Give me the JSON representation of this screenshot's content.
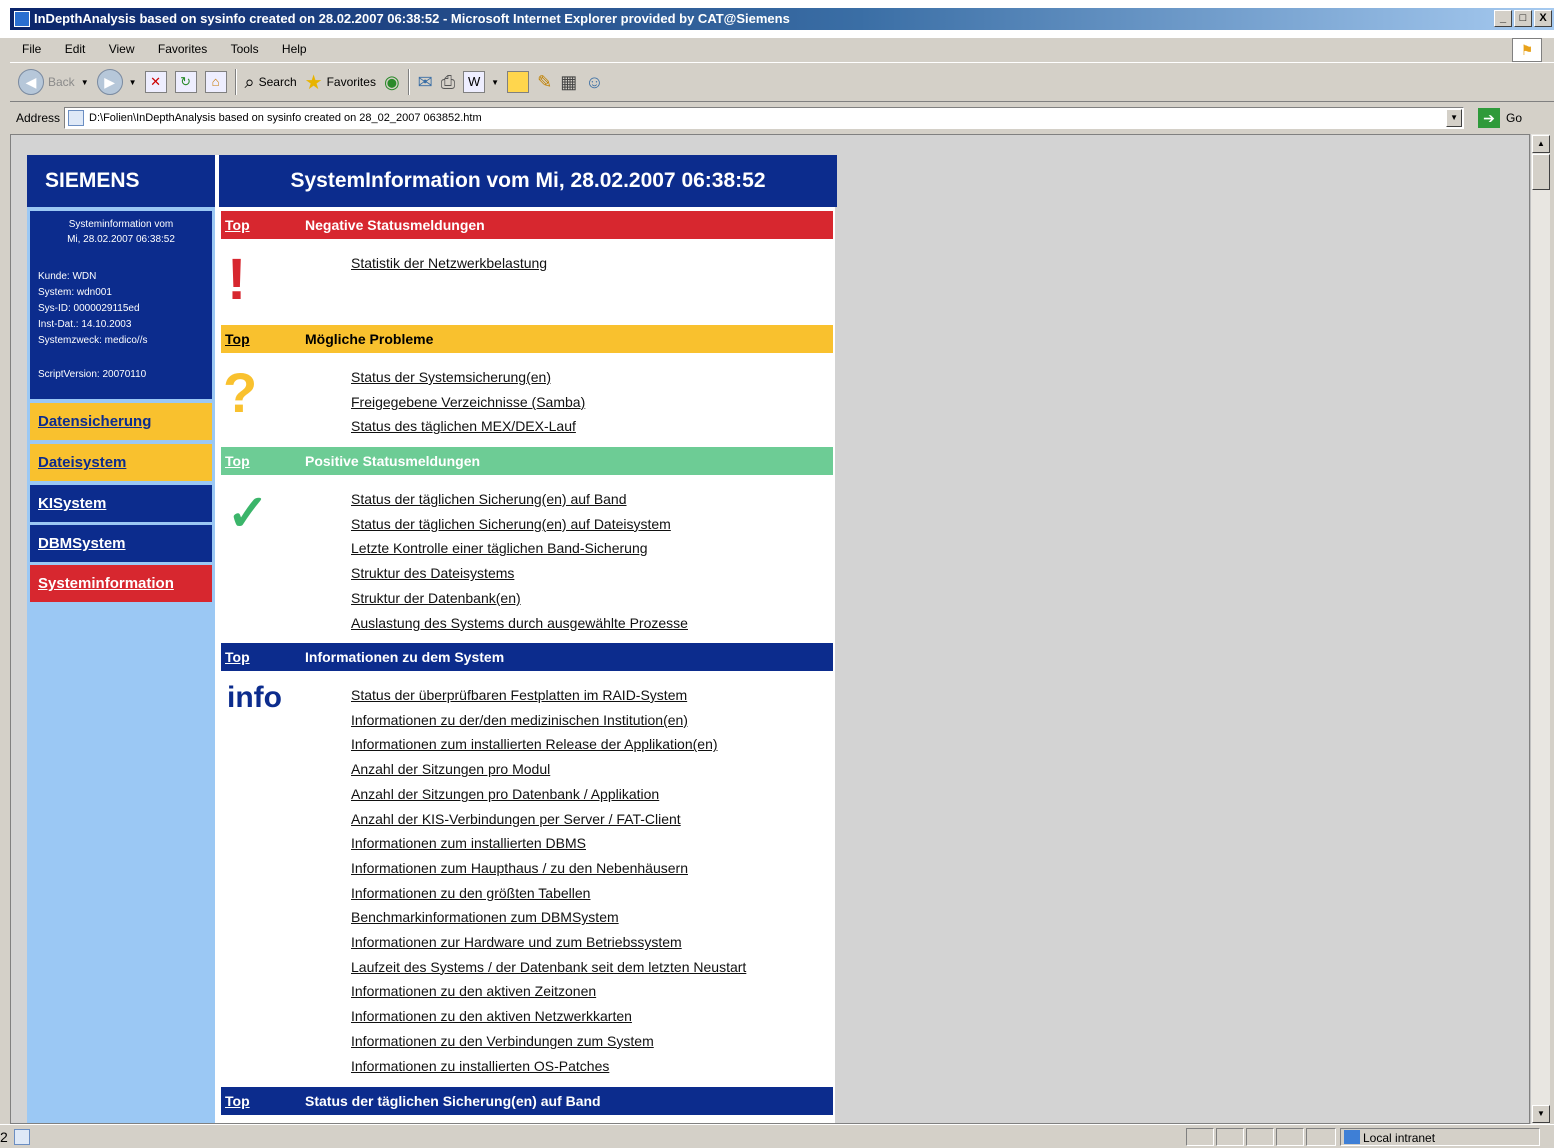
{
  "window": {
    "title": "InDepthAnalysis based on sysinfo created on 28.02.2007 06:38:52 - Microsoft Internet Explorer provided by CAT@Siemens",
    "buttons": [
      "_",
      "□",
      "X"
    ]
  },
  "menu": [
    "File",
    "Edit",
    "View",
    "Favorites",
    "Tools",
    "Help"
  ],
  "toolbar": {
    "back": "Back",
    "search": "Search",
    "favorites": "Favorites"
  },
  "address": {
    "label": "Address",
    "value": "D:\\Folien\\InDepthAnalysis based on sysinfo created on 28_02_2007 063852.htm",
    "go": "Go"
  },
  "sidebar": {
    "brand": "SIEMENS",
    "info_title_1": "Systeminformation vom",
    "info_title_2": "Mi, 28.02.2007 06:38:52",
    "kunde": "Kunde: WDN",
    "system": "System: wdn001",
    "sysid": "Sys-ID: 0000029115ed",
    "instdat": "Inst-Dat.: 14.10.2003",
    "zweck": "Systemzweck: medico//s",
    "script": "ScriptVersion: 20070110",
    "nav": [
      "Datensicherung",
      "Dateisystem",
      "KISystem",
      "DBMSystem",
      "Systeminformation"
    ]
  },
  "main": {
    "header": "SystemInformation vom Mi, 28.02.2007 06:38:52",
    "top_label": "Top",
    "sections": [
      {
        "title": "Negative Statusmeldungen",
        "symbol": "!",
        "links": [
          "Statistik der Netzwerkbelastung"
        ]
      },
      {
        "title": "Mögliche Probleme",
        "symbol": "?",
        "links": [
          "Status der Systemsicherung(en)",
          "Freigegebene Verzeichnisse (Samba)",
          "Status des täglichen MEX/DEX-Lauf"
        ]
      },
      {
        "title": "Positive Statusmeldungen",
        "symbol": "✓",
        "links": [
          "Status der täglichen Sicherung(en) auf Band",
          "Status der täglichen Sicherung(en) auf Dateisystem",
          "Letzte Kontrolle einer täglichen Band-Sicherung",
          "Struktur des Dateisystems",
          "Struktur der Datenbank(en)",
          "Auslastung des Systems durch ausgewählte Prozesse"
        ]
      },
      {
        "title": "Informationen zu dem System",
        "symbol": "info",
        "links": [
          "Status der überprüfbaren Festplatten im RAID-System",
          "Informationen zu der/den medizinischen Institution(en)",
          "Informationen zum installierten Release der Applikation(en)",
          "Anzahl der Sitzungen pro Modul",
          "Anzahl der Sitzungen pro Datenbank / Applikation",
          "Anzahl der KIS-Verbindungen per Server / FAT-Client",
          "Informationen zum installierten DBMS",
          "Informationen zum Haupthaus / zu den Nebenhäusern",
          "Informationen zu den größten Tabellen",
          "Benchmarkinformationen zum DBMSystem",
          "Informationen zur Hardware und zum Betriebssystem",
          "Laufzeit des Systems / der Datenbank seit dem letzten Neustart",
          "Informationen zu den aktiven Zeitzonen",
          "Informationen zu den aktiven Netzwerkkarten",
          "Informationen zu den Verbindungen zum System",
          "Informationen zu installierten OS-Patches"
        ]
      },
      {
        "title": "Status der täglichen Sicherung(en) auf Band"
      }
    ]
  },
  "status": {
    "left": "2",
    "zone": "Local intranet"
  },
  "colors": {
    "siemens_blue": "#0c2c8d",
    "sidebar_bg": "#9bc8f4",
    "red": "#d7272f",
    "yellow": "#f9c12e",
    "green": "#6dcc95"
  }
}
